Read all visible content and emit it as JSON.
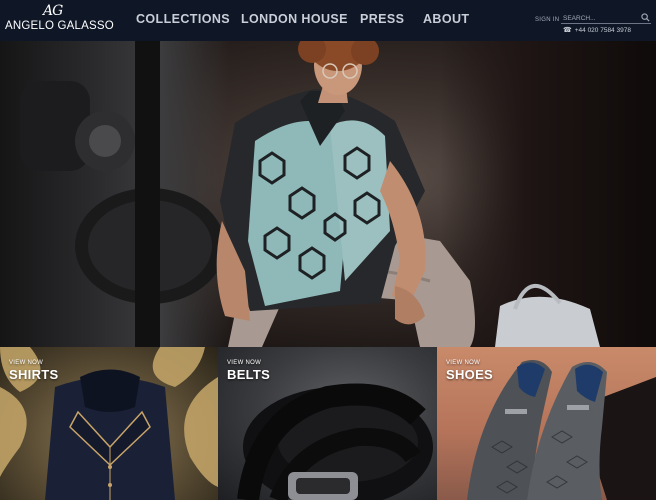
{
  "brand": {
    "monogram": "AG",
    "name": "ANGELO GALASSO"
  },
  "nav": {
    "items": [
      {
        "label": "COLLECTIONS"
      },
      {
        "label": "LONDON HOUSE"
      },
      {
        "label": "PRESS"
      },
      {
        "label": "ABOUT"
      }
    ]
  },
  "account": {
    "signin_label": "SIGN IN"
  },
  "search": {
    "placeholder": "SEARCH...",
    "icon": "search-icon"
  },
  "contact": {
    "phone": "+44 020 7584 3978",
    "icon": "phone-icon"
  },
  "hero": {
    "description_icon": "hero-photo"
  },
  "categories": [
    {
      "kicker": "VIEW NOW",
      "title": "SHIRTS"
    },
    {
      "kicker": "VIEW NOW",
      "title": "BELTS"
    },
    {
      "kicker": "VIEW NOW",
      "title": "SHOES"
    }
  ],
  "colors": {
    "header_bg": "#0f1726",
    "nav_text": "#c9ced8",
    "tile_text": "#ffffff"
  }
}
